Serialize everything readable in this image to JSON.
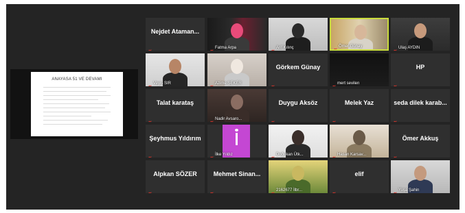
{
  "shared_screen": {
    "title": "ANAYASA 51 VE DEVAMI"
  },
  "participants": [
    {
      "name": "Nejdet Ataman...",
      "style": "name",
      "active": false
    },
    {
      "name": "Fatma Arpa",
      "style": "video",
      "active": false
    },
    {
      "name": "Arif Kılınç",
      "style": "video",
      "active": false
    },
    {
      "name": "Ömer Günay",
      "style": "video",
      "active": true
    },
    {
      "name": "Ulaş AYDIN",
      "style": "video",
      "active": false
    },
    {
      "name": "Veyis SIR",
      "style": "video",
      "active": false
    },
    {
      "name": "Azime ŞEKER",
      "style": "video",
      "active": false
    },
    {
      "name": "Görkem Günay",
      "style": "name",
      "active": false
    },
    {
      "name": "mert sevilen",
      "style": "video",
      "active": false
    },
    {
      "name": "HP",
      "style": "name",
      "active": false
    },
    {
      "name": "Talat karataş",
      "style": "name",
      "active": false
    },
    {
      "name": "Nadir Avsaro...",
      "style": "video",
      "active": false
    },
    {
      "name": "Duygu Aksöz",
      "style": "name",
      "active": false
    },
    {
      "name": "Melek Yaz",
      "style": "name",
      "active": false
    },
    {
      "name": "seda dilek karab...",
      "style": "name",
      "active": false
    },
    {
      "name": "Şeyhmus Yıldırım",
      "style": "name",
      "active": false
    },
    {
      "name": "İlke Yıldız",
      "style": "video",
      "active": false
    },
    {
      "name": "Doğukan Ütk...",
      "style": "video",
      "active": false
    },
    {
      "name": "Hasan Karsav...",
      "style": "video",
      "active": false
    },
    {
      "name": "Ömer Akkuş",
      "style": "name",
      "active": false
    },
    {
      "name": "Alpkan SÖZER",
      "style": "name",
      "active": false
    },
    {
      "name": "Mehmet Sinan...",
      "style": "name",
      "active": false
    },
    {
      "name": "2162677 İlbr...",
      "style": "video",
      "active": false
    },
    {
      "name": "elif",
      "style": "name",
      "active": false
    },
    {
      "name": "Yuşa Şahin",
      "style": "video",
      "active": false
    }
  ],
  "colors": {
    "background": "#242424",
    "tile": "#2f2f2f",
    "active_border": "#c9dc3c",
    "muted_mic": "#e0352b"
  }
}
